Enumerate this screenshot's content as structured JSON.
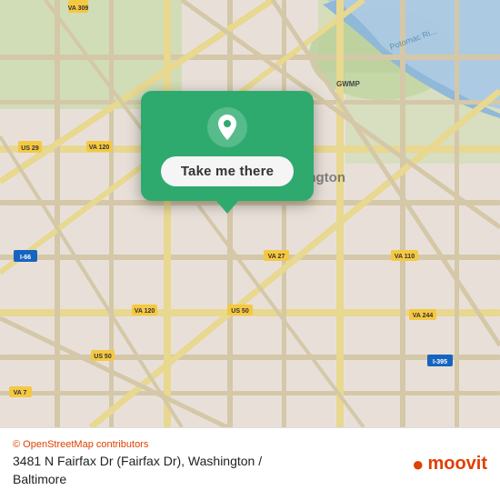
{
  "map": {
    "alt": "Map of Arlington, Virginia area showing 3481 N Fairfax Dr"
  },
  "popup": {
    "take_me_there_label": "Take me there"
  },
  "bottom_bar": {
    "osm_credit": "© OpenStreetMap contributors",
    "address": "3481 N Fairfax Dr (Fairfax Dr), Washington /",
    "address_line2": "Baltimore",
    "moovit_label": "moovit"
  }
}
